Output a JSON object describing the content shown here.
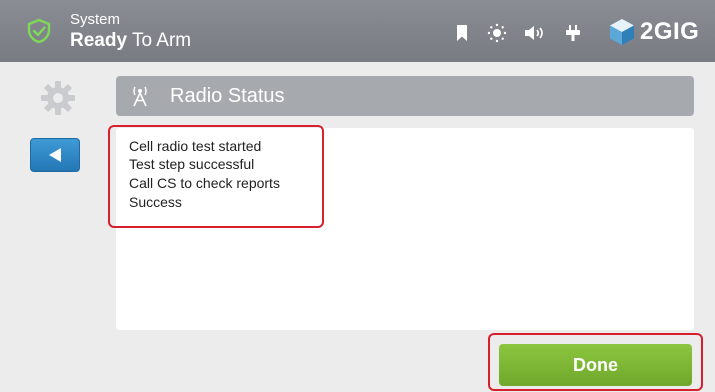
{
  "status_bar": {
    "label_small": "System",
    "label_bold": "Ready",
    "label_rest": "To Arm",
    "icons": [
      "shield-check-icon",
      "bookmark-icon",
      "brightness-icon",
      "volume-icon",
      "power-plug-icon"
    ],
    "brand": "2GIG",
    "brand_color": "#5aa7d8"
  },
  "header": {
    "title": "Radio Status",
    "icon": "radio-tower-icon"
  },
  "nav": {
    "settings_icon": "gear-icon",
    "back_icon": "back-arrow-icon"
  },
  "log": {
    "lines": [
      "Cell radio test started",
      "Test step successful",
      "Call CS to check reports",
      "Success"
    ]
  },
  "actions": {
    "done_label": "Done"
  },
  "colors": {
    "accent_green": "#7ab632",
    "accent_blue": "#2f88c9",
    "highlight_red": "#d8202c"
  }
}
